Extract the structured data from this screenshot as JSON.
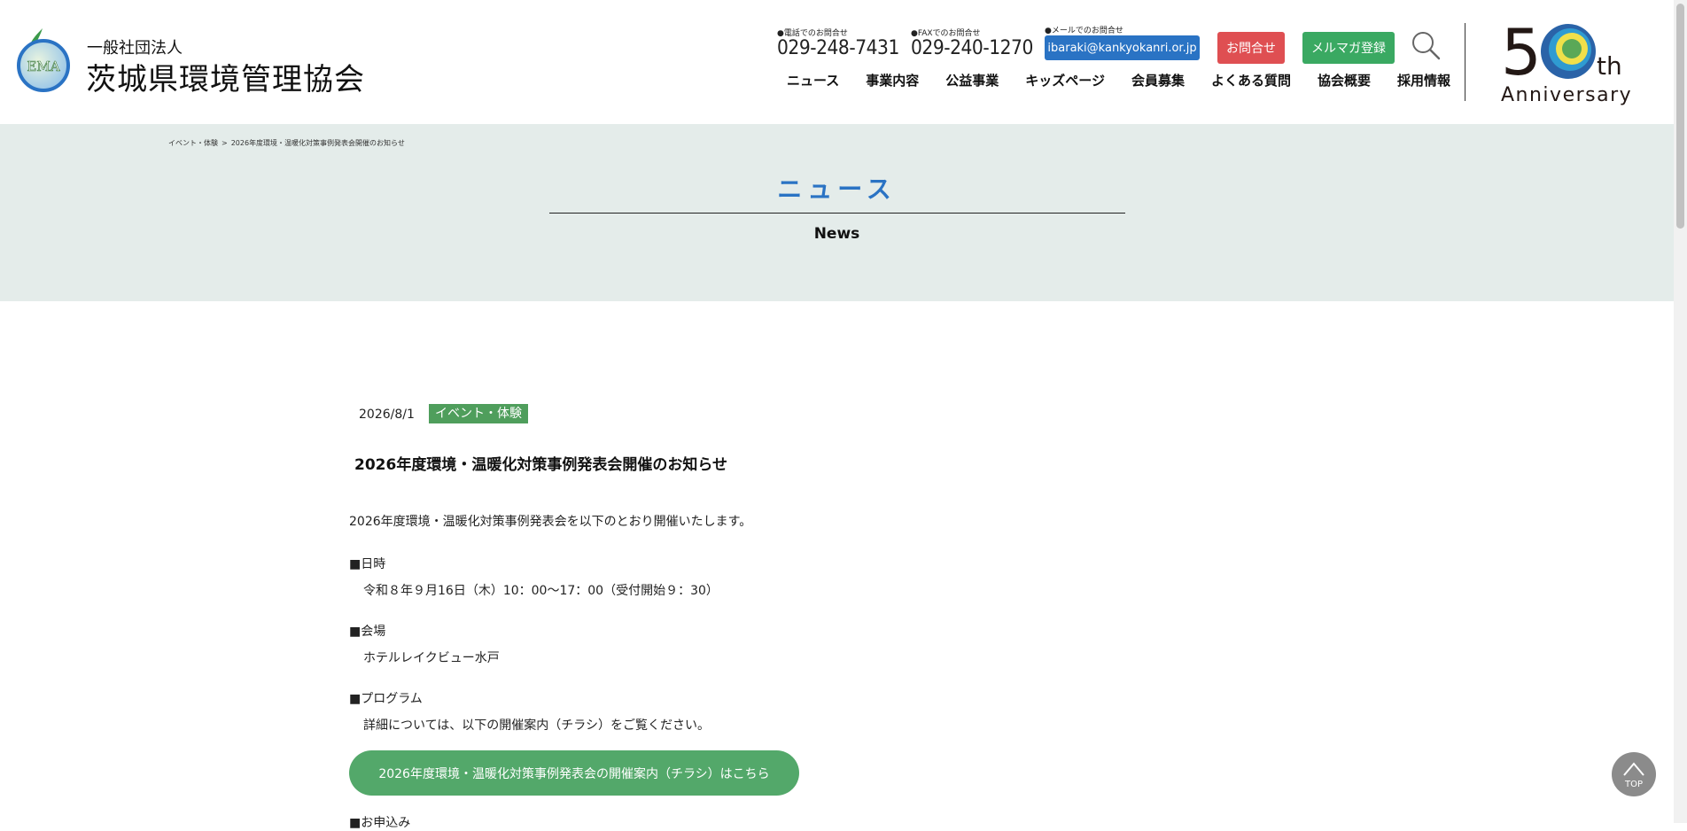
{
  "header": {
    "logo_text": "EMA",
    "org_type": "一般社団法人",
    "org_name": "茨城県環境管理協会",
    "tel_label": "●電話でのお問合せ",
    "tel_number": "029-248-7431",
    "fax_label": "●FAXでのお問合せ",
    "fax_number": "029-240-1270",
    "mail_label": "●メールでのお問合せ",
    "mail_address": "ibaraki@kankyokanri.or.jp",
    "contact_label": "お問合せ",
    "mailmag_label": "メルマガ登録",
    "nav": [
      {
        "label": "ニュース"
      },
      {
        "label": "事業内容"
      },
      {
        "label": "公益事業"
      },
      {
        "label": "キッズページ"
      },
      {
        "label": "会員募集"
      },
      {
        "label": "よくある質問"
      },
      {
        "label": "協会概要"
      },
      {
        "label": "採用情報"
      }
    ],
    "anniversary": {
      "number_5": "5",
      "suffix": "th",
      "word": "Anniversary"
    }
  },
  "breadcrumb": [
    "イベント・体験",
    "2026年度環境・温暖化対策事例発表会開催のお知らせ"
  ],
  "breadcrumb_sep": ">",
  "page_title": "ニュース",
  "page_subtitle": "News",
  "article": {
    "date": "2026/8/1",
    "category": "イベント・体験",
    "title": "2026年度環境・温暖化対策事例発表会開催のお知らせ",
    "intro": "2026年度環境・温暖化対策事例発表会を以下のとおり開催いたします。",
    "date_heading": "■日時",
    "date_body": "令和８年９月16日（木）10：00〜17：00（受付開始９：30）",
    "venue_heading": "■会場",
    "venue_body": "ホテルレイクビュー水戸",
    "program_heading": "■プログラム",
    "program_body": "詳細については、以下の開催案内（チラシ）をご覧ください。",
    "flyer_button": "2026年度環境・温暖化対策事例発表会の開催案内（チラシ）はこちら",
    "apply_heading": "■お申込み"
  },
  "top_button_label": "TOP",
  "colors": {
    "accent_blue": "#2a73c4",
    "contact_red": "#df4f52",
    "mailmag_green": "#3aa962",
    "category_green": "#4f9e5c",
    "title_band": "#e4ecea"
  }
}
